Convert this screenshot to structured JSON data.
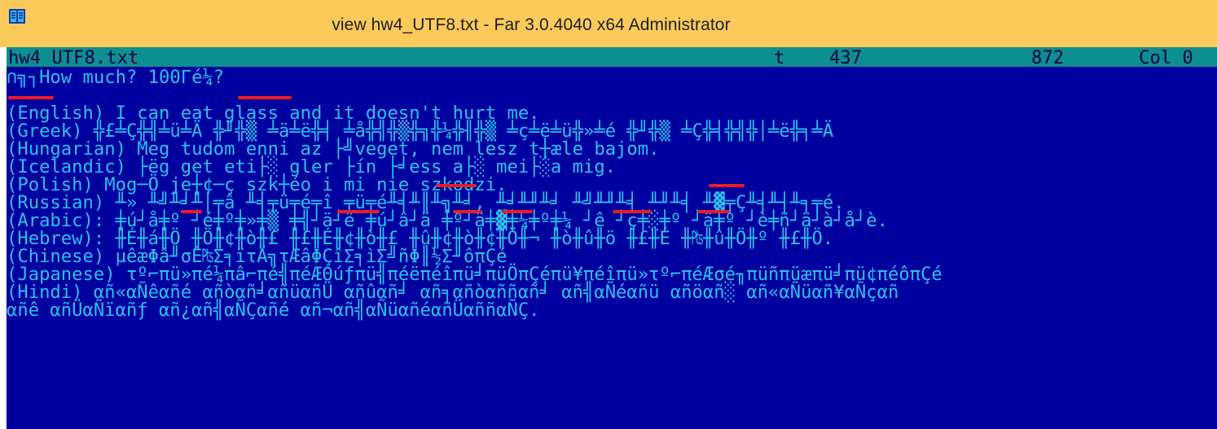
{
  "window": {
    "title": "view hw4_UTF8.txt - Far 3.0.4040 x64 Administrator",
    "app_icon": "far-manager-book-icon",
    "titlebar_color": "#fbca5a"
  },
  "viewer": {
    "status": {
      "filename": "hw4_UTF8.txt",
      "codepage": "t",
      "codepage_number": "437",
      "file_size": "872",
      "column": "Col 0"
    },
    "lines": [
      "∩╗┐How much? 100Γé¼?",
      "",
      "(English) I can eat glass and it doesn't hurt me.",
      "(Greek) ╬£╧Ç╬╣╧ü╧Ä ╬╜╬▒ ╧ä╧ë╬╡ ╧å╬╣╬▒╬╗╬¼╬╢╬▒ ╧ç╧ë╧ü╬»╧é ╬╜╬▒ ╧Ç╬╡╬╣╬│╧ë╬╕╧Ä",
      "(Hungarian) Meg tudom enni az ├╝veget, nem lesz t┼æle bajom.",
      "(Icelandic) ├ëg get eti├░ gler ├ín ├╛ess a├░ mei├░a mig.",
      "(Polish) Mog─Ö je┼¢─ç szk┼éo i mi nie szkodzi.",
      "(Russian) ╨» ╨╝╨╛╨│╤â ╨╡╤ü╤é╤î ╤ü╤é╨╡╨║╨╗╨╛, ╨╛╨╜╨╛ ╨╝╨╜╨╡ ╨╜╨╡ ╨▓╤Ç╨╡╨┤╨╕╤é.",
      "(Arabic): ╪ú┘å╪º ┘é╪º╪»╪▒ ╪╣┘ä┘ë ╪ú┘â┘ä ╪º┘ä╪▓╪¼╪º╪¼ ┘ê ┘ç╪░╪º ┘ä╪º ┘è╪ñ┘ä┘à┘å┘è.",
      "(Hebrew): ╫É╫á╫Ö ╫Ö╫¢╫ò╫£ ╫£╫É╫¢╫ò╫£ ╫û╫¢╫ò╫¢╫Ö╫¬ ╫ò╫û╫ö ╫£╫É ╫₧╫û╫Ö╫º ╫£╫Ö.",
      "(Chinese) µêæΦâ╜σÉ₧Σ╕ïτÄ╗τÆâΦÇîΣ╕ìΣ╝ñΦ║½Σ╜ôπÇé",
      "(Japanese) τº⌐πü»πé¼πâ⌐πé╣πéÆΘúƒπü╣πéëπéîπü╛πüÖπÇéπü¥πéîπü»τº⌐πéÆσé╖πüñπüæπü╛πü¢πéôπÇé",
      "(Hindi) αñ«αÑêαñé αñòαñ╛αñüαñÜ αñûαñ╛ αñ╕αñòαññαñ╛ αñ╣αÑéαñü αñöαñ░ αñ«αÑüαñ¥αÑçαñ",
      "αñê αñÜαÑïαñƒ αñ¿αñ╣αÑÇαñé αñ¬αñ╣αÑüαñéαñÜαññαÑÇ."
    ]
  },
  "colors": {
    "console_bg": "#00009f",
    "console_text": "#2dc0f0",
    "status_bg": "#0d8f8f",
    "status_text": "#00004a",
    "annotation": "#ee1b23"
  }
}
